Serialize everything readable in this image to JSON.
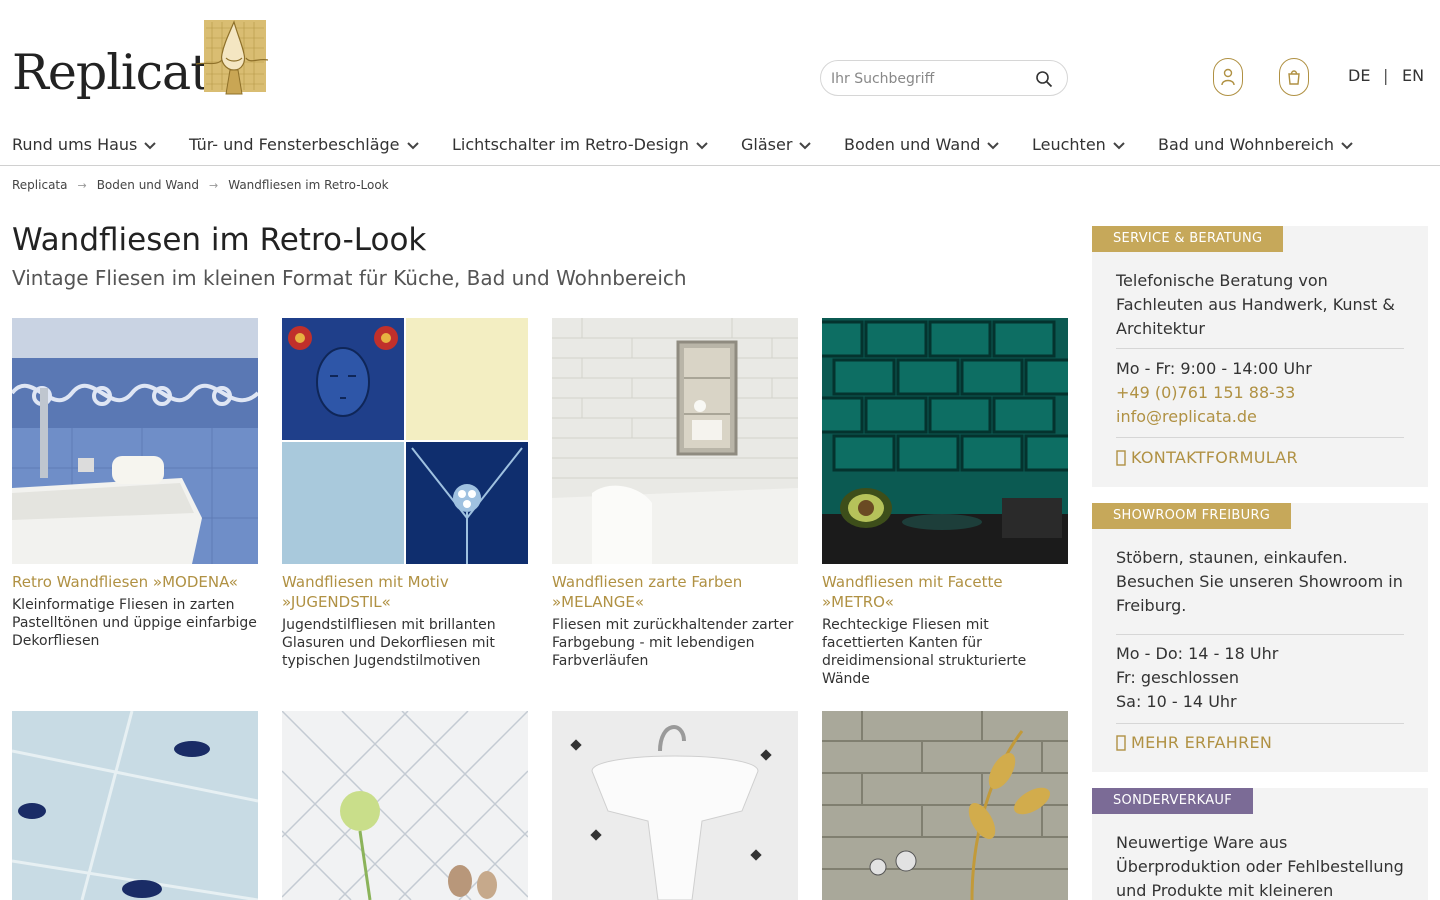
{
  "header": {
    "logo_text": "Replicata",
    "search_placeholder": "Ihr Suchbegriff",
    "lang_de": "DE",
    "lang_sep": "|",
    "lang_en": "EN"
  },
  "nav": {
    "items": [
      "Rund ums Haus",
      "Tür- und Fensterbeschläge",
      "Lichtschalter im Retro-Design",
      "Gläser",
      "Boden und Wand",
      "Leuchten",
      "Bad und Wohnbereich"
    ]
  },
  "breadcrumb": [
    "Replicata",
    "Boden und Wand",
    "Wandfliesen im Retro-Look"
  ],
  "breadcrumb_sep": "→",
  "page": {
    "title": "Wandfliesen im Retro-Look",
    "subtitle": "Vintage Fliesen im kleinen Format für Küche, Bad und Wohnbereich"
  },
  "products": [
    {
      "name": "Retro Wandfliesen »MODENA«",
      "desc": "Kleinformatige Fliesen in zarten Pastelltönen und üppige einfarbige Dekorfliesen"
    },
    {
      "name": "Wandfliesen mit Motiv »JUGENDSTIL«",
      "desc": "Jugendstilfliesen mit brillanten Glasuren und Dekorfliesen mit typischen Jugendstilmotiven"
    },
    {
      "name": "Wandfliesen zarte Farben »MELANGE«",
      "desc": "Fliesen mit zurückhaltender zarter Farbgebung - mit lebendigen Farbverläufen"
    },
    {
      "name": "Wandfliesen mit Facette »METRO«",
      "desc": "Rechteckige Fliesen mit facettierten Kanten für dreidimensional strukturierte Wände"
    }
  ],
  "sidebar": {
    "service": {
      "tag": "SERVICE & BERATUNG",
      "intro": "Telefonische Beratung von Fachleuten aus Handwerk, Kunst & Architektur",
      "hours": "Mo - Fr: 9:00 - 14:00 Uhr",
      "phone": "+49 (0)761 151 88-33",
      "email": "info@replicata.de",
      "link": "KONTAKTFORMULAR"
    },
    "showroom": {
      "tag": "SHOWROOM FREIBURG",
      "intro": "Stöbern, staunen, einkaufen. Besuchen Sie unseren Showroom in Freiburg.",
      "hours_1": "Mo - Do: 14 - 18 Uhr",
      "hours_2": "Fr: geschlossen",
      "hours_3": "Sa: 10 - 14 Uhr",
      "link": "MEHR ERFAHREN"
    },
    "sale": {
      "tag": "SONDERVERKAUF",
      "intro": "Neuwertige Ware aus Überproduktion oder Fehlbestellung und Produkte mit kleineren"
    }
  },
  "colors": {
    "gold": "#b09143",
    "service_tag": "#c6a85a",
    "sale_tag": "#7b6b96"
  },
  "icons": [
    "search-icon",
    "user-icon",
    "cart-icon",
    "chevron-down-icon",
    "arrow-right-icon"
  ]
}
